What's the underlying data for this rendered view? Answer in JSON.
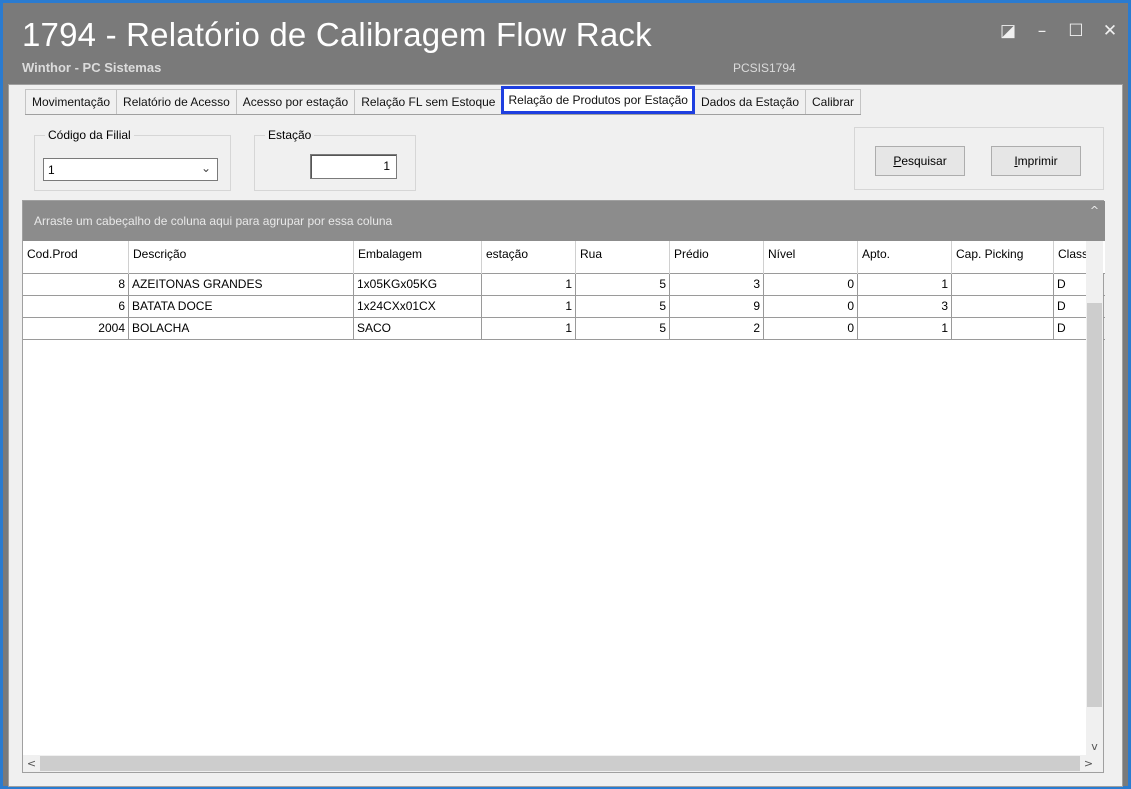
{
  "window": {
    "title": "1794 - Relatório de Calibragem Flow Rack",
    "subtitle": "Winthor - PC Sistemas",
    "code": "PCSIS1794",
    "controls": {
      "restore": "◪",
      "minimize": "–",
      "maximize": "☐",
      "close": "✕"
    }
  },
  "tabs": [
    {
      "label": "Movimentação"
    },
    {
      "label": "Relatório de Acesso"
    },
    {
      "label": "Acesso por estação"
    },
    {
      "label": "Relação FL sem Estoque"
    },
    {
      "label": "Relação de Produtos por Estação",
      "active": true
    },
    {
      "label": "Dados da Estação"
    },
    {
      "label": "Calibrar"
    }
  ],
  "filters": {
    "filial_label": "Código da Filial",
    "filial_value": "1",
    "estacao_label": "Estação",
    "estacao_value": "1"
  },
  "buttons": {
    "pesquisar_key": "P",
    "pesquisar_rest": "esquisar",
    "imprimir_key": "I",
    "imprimir_rest": "mprimir"
  },
  "grid": {
    "group_hint": "Arraste um cabeçalho de coluna aqui para agrupar por essa coluna",
    "columns": [
      "Cod.Prod",
      "Descrição",
      "Embalagem",
      "estação",
      "Rua",
      "Prédio",
      "Nível",
      "Apto.",
      "Cap. Picking",
      "Classe"
    ],
    "rows": [
      [
        "8",
        "AZEITONAS GRANDES",
        "1x05KGx05KG",
        "1",
        "5",
        "3",
        "0",
        "1",
        "",
        "D"
      ],
      [
        "6",
        "BATATA DOCE",
        "1x24CXx01CX",
        "1",
        "5",
        "9",
        "0",
        "3",
        "",
        "D"
      ],
      [
        "2004",
        "BOLACHA",
        "SACO",
        "1",
        "5",
        "2",
        "0",
        "1",
        "",
        "D"
      ]
    ]
  },
  "scroll": {
    "up": "^",
    "down": "v",
    "left": "<",
    "right": ">"
  }
}
